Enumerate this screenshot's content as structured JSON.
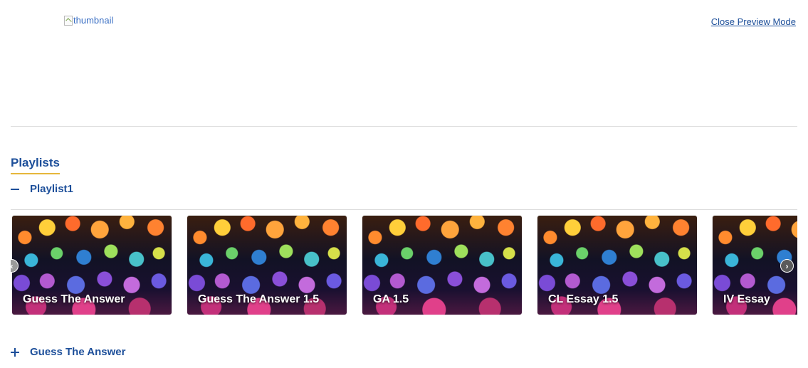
{
  "header": {
    "thumbnail_alt": "thumbnail",
    "close_preview_label": "Close Preview Mode"
  },
  "section": {
    "title": "Playlists"
  },
  "playlists": [
    {
      "name": "Playlist1",
      "expanded": true,
      "items": [
        {
          "title": "Guess The Answer"
        },
        {
          "title": "Guess The Answer 1.5"
        },
        {
          "title": "GA 1.5"
        },
        {
          "title": "CL Essay 1.5"
        },
        {
          "title": "IV Essay"
        }
      ]
    },
    {
      "name": "Guess The Answer",
      "expanded": false
    }
  ],
  "icons": {
    "collapse": "minus-icon",
    "expand": "plus-icon",
    "carousel_prev": "chevron-left-icon",
    "carousel_next": "chevron-right-icon"
  },
  "colors": {
    "accent": "#1d4f9a",
    "underline": "#e6b73b"
  }
}
